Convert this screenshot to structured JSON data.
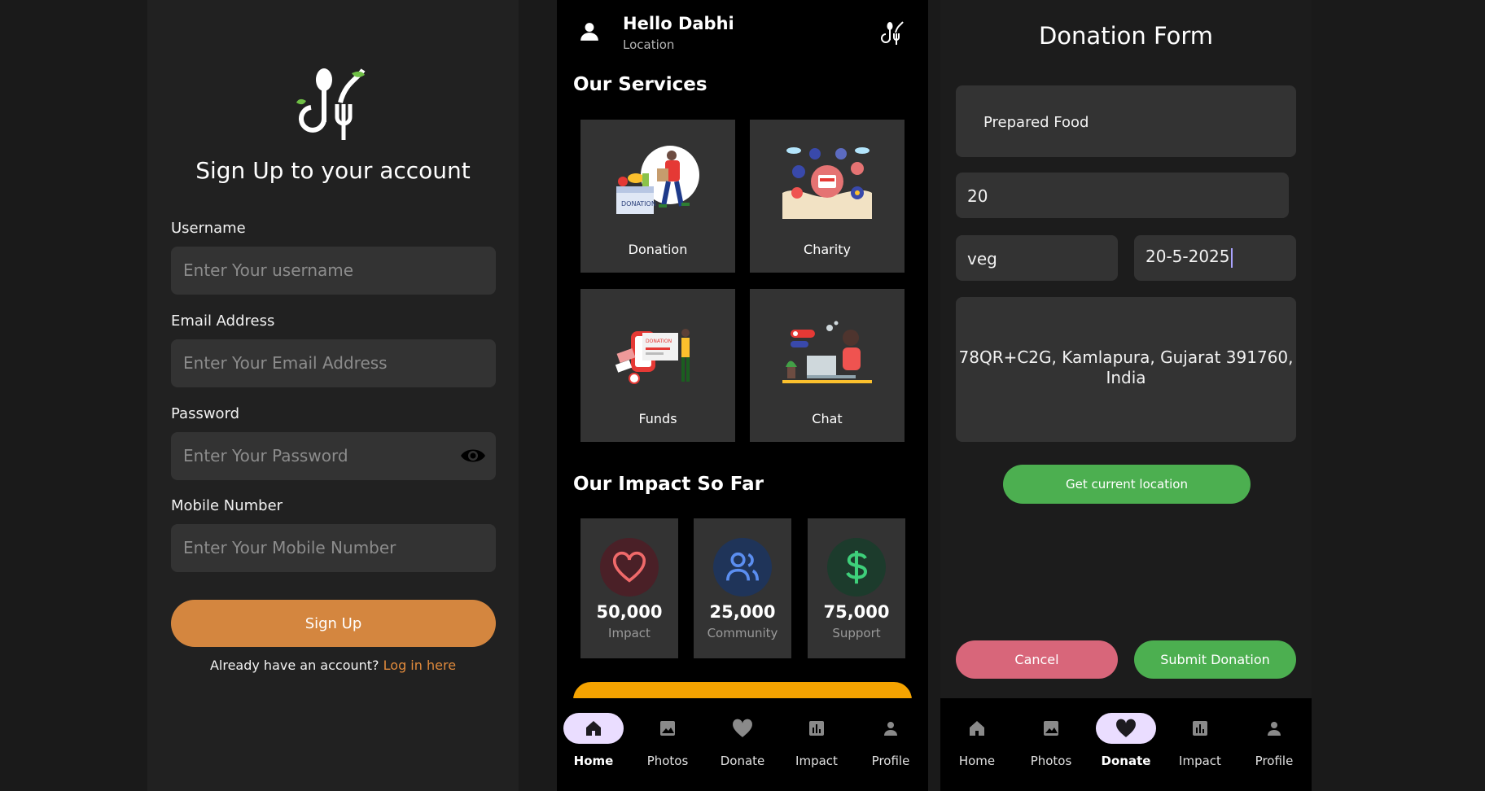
{
  "signup": {
    "heading": "Sign Up to your account",
    "username_label": "Username",
    "username_placeholder": "Enter Your username",
    "email_label": "Email Address",
    "email_placeholder": "Enter Your Email Address",
    "password_label": "Password",
    "password_placeholder": "Enter Your Password",
    "mobile_label": "Mobile Number",
    "mobile_placeholder": "Enter Your Mobile Number",
    "signup_button": "Sign Up",
    "login_prompt": "Already have an account?",
    "login_link": "Log in here",
    "colors": {
      "primary": "#d4863f",
      "link": "#e08a3c"
    }
  },
  "home": {
    "greeting": "Hello Dabhi",
    "location": "Location",
    "services_title": "Our Services",
    "services": [
      {
        "label": "Donation",
        "icon": "donation-illustration"
      },
      {
        "label": "Charity",
        "icon": "charity-illustration"
      },
      {
        "label": "Funds",
        "icon": "funds-illustration"
      },
      {
        "label": "Chat",
        "icon": "chat-illustration"
      }
    ],
    "impact_title": "Our Impact So Far",
    "stats": [
      {
        "value": "50,000",
        "label": "Impact",
        "icon": "heart-icon",
        "color": "#f06a6a"
      },
      {
        "value": "25,000",
        "label": "Community",
        "icon": "users-icon",
        "color": "#5b8ef0"
      },
      {
        "value": "75,000",
        "label": "Support",
        "icon": "dollar-icon",
        "color": "#3ecf7a"
      }
    ]
  },
  "nav": {
    "items": [
      {
        "label": "Home",
        "icon": "home-icon"
      },
      {
        "label": "Photos",
        "icon": "photos-icon"
      },
      {
        "label": "Donate",
        "icon": "heart-icon"
      },
      {
        "label": "Impact",
        "icon": "bar-chart-icon"
      },
      {
        "label": "Profile",
        "icon": "person-icon"
      }
    ],
    "active_home_screen": "Home",
    "active_form_screen": "Donate"
  },
  "donation_form": {
    "title": "Donation Form",
    "food_type": "Prepared Food",
    "quantity": "20",
    "diet": "veg",
    "date": "20-5-2025",
    "address": "78QR+C2G, Kamlapura, Gujarat 391760, India",
    "get_location_button": "Get current location",
    "cancel_button": "Cancel",
    "submit_button": "Submit Donation",
    "colors": {
      "green": "#4caf50",
      "cancel": "#d8667a"
    }
  }
}
